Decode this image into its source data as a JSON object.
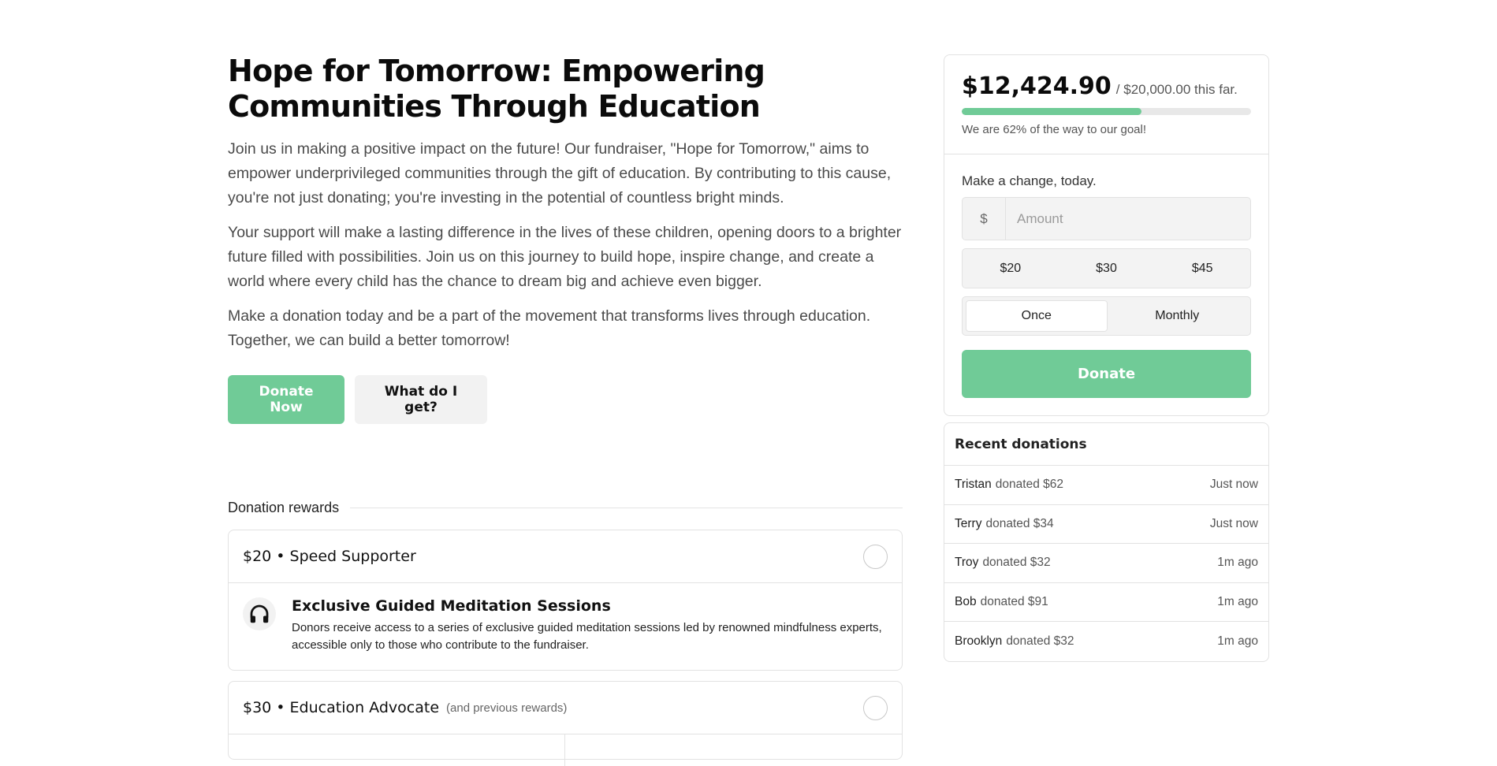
{
  "campaign": {
    "title": "Hope for Tomorrow: Empowering Communities Through Education",
    "paragraphs": [
      "Join us in making a positive impact on the future! Our fundraiser, \"Hope for Tomorrow,\" aims to empower underprivileged communities through the gift of education. By contributing to this cause, you're not just donating; you're investing in the potential of countless bright minds.",
      "Your support will make a lasting difference in the lives of these children, opening doors to a brighter future filled with possibilities. Join us on this journey to build hope, inspire change, and create a world where every child has the chance to dream big and achieve even bigger.",
      "Make a donation today and be a part of the movement that transforms lives through education. Together, we can build a better tomorrow!"
    ],
    "donate_now_label": "Donate Now",
    "what_do_i_get_label": "What do I get?"
  },
  "rewards": {
    "heading": "Donation rewards",
    "tiers": [
      {
        "title": "$20 • Speed Supporter",
        "subtitle": "",
        "perk_icon": "headphones-icon",
        "perk_title": "Exclusive Guided Meditation Sessions",
        "perk_desc": "Donors receive access to a series of exclusive guided meditation sessions led by renowned mindfulness experts, accessible only to those who contribute to the fundraiser."
      },
      {
        "title": "$30 • Education Advocate",
        "subtitle": "(and previous rewards)"
      }
    ]
  },
  "goal": {
    "raised": "$12,424.90",
    "target_text": "/ $20,000.00 this far.",
    "progress_fraction": 0.62,
    "note": "We are 62% of the way to our goal!"
  },
  "donate_form": {
    "label": "Make a change, today.",
    "currency_symbol": "$",
    "amount_placeholder": "Amount",
    "presets": [
      "$20",
      "$30",
      "$45"
    ],
    "frequency": [
      "Once",
      "Monthly"
    ],
    "selected_frequency": "Once",
    "donate_label": "Donate"
  },
  "recent": {
    "title": "Recent donations",
    "items": [
      {
        "name": "Tristan",
        "text": "donated $62",
        "time": "Just now"
      },
      {
        "name": "Terry",
        "text": "donated $34",
        "time": "Just now"
      },
      {
        "name": "Troy",
        "text": "donated $32",
        "time": "1m ago"
      },
      {
        "name": "Bob",
        "text": "donated $91",
        "time": "1m ago"
      },
      {
        "name": "Brooklyn",
        "text": "donated $32",
        "time": "1m ago"
      }
    ]
  },
  "colors": {
    "accent": "#70cb97",
    "border": "#e2e2e2",
    "muted_bg": "#f3f3f3"
  }
}
